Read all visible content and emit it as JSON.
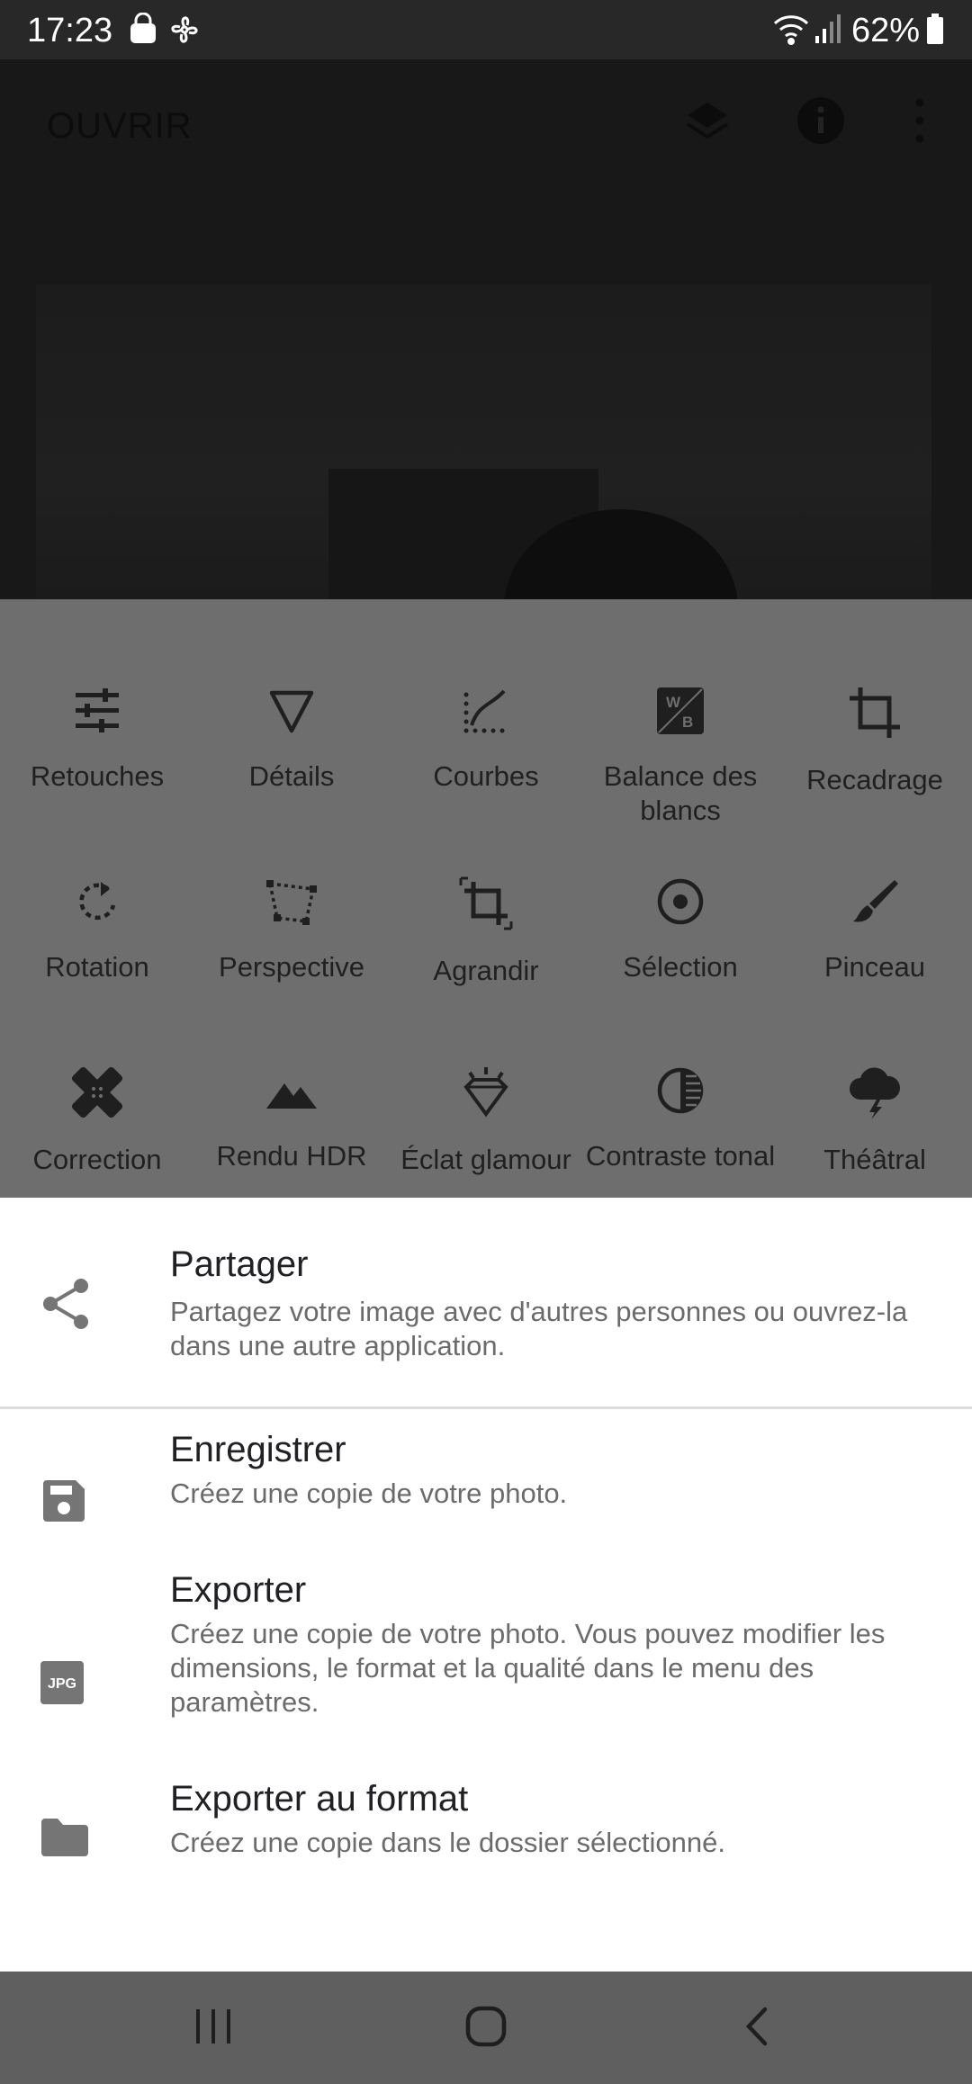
{
  "status_bar": {
    "time": "17:23",
    "battery": "62%",
    "icons": [
      "shopping-bag-icon",
      "pinwheel-icon",
      "wifi-icon",
      "signal-icon",
      "battery-icon"
    ]
  },
  "app_bar": {
    "open_label": "OUVRIR",
    "icons": [
      "layers-icon",
      "info-icon",
      "more-vert-icon"
    ]
  },
  "tools": [
    {
      "label": "Retouches",
      "icon": "tune-icon"
    },
    {
      "label": "Détails",
      "icon": "details-triangle-icon"
    },
    {
      "label": "Courbes",
      "icon": "curves-icon"
    },
    {
      "label": "Balance des blancs",
      "icon": "white-balance-icon"
    },
    {
      "label": "Recadrage",
      "icon": "crop-icon"
    },
    {
      "label": "Rotation",
      "icon": "rotate-icon"
    },
    {
      "label": "Perspective",
      "icon": "perspective-icon"
    },
    {
      "label": "Agrandir",
      "icon": "expand-icon"
    },
    {
      "label": "Sélection",
      "icon": "selection-icon"
    },
    {
      "label": "Pinceau",
      "icon": "brush-icon"
    },
    {
      "label": "Correction",
      "icon": "healing-icon"
    },
    {
      "label": "Rendu HDR",
      "icon": "hdr-mountains-icon"
    },
    {
      "label": "Éclat glamour",
      "icon": "glamour-diamond-icon"
    },
    {
      "label": "Contraste tonal",
      "icon": "tonal-contrast-icon"
    },
    {
      "label": "Théâtral",
      "icon": "drama-cloud-icon"
    }
  ],
  "sheet": {
    "share": {
      "title": "Partager",
      "description": "Partagez votre image avec d'autres personnes ou ouvrez-la dans une autre application.",
      "icon": "share-icon"
    },
    "save": {
      "title": "Enregistrer",
      "description": "Créez une copie de votre photo.",
      "icon": "save-icon"
    },
    "export": {
      "title": "Exporter",
      "description": "Créez une copie de votre photo. Vous pouvez modifier les dimensions, le format et la qualité dans le menu des paramètres.",
      "icon": "jpg-icon",
      "icon_text": "JPG"
    },
    "export_as": {
      "title": "Exporter au format",
      "description": "Créez une copie dans le dossier sélectionné.",
      "icon": "folder-icon"
    }
  },
  "nav_bar": {
    "buttons": [
      "recents-icon",
      "home-icon",
      "back-icon"
    ]
  }
}
